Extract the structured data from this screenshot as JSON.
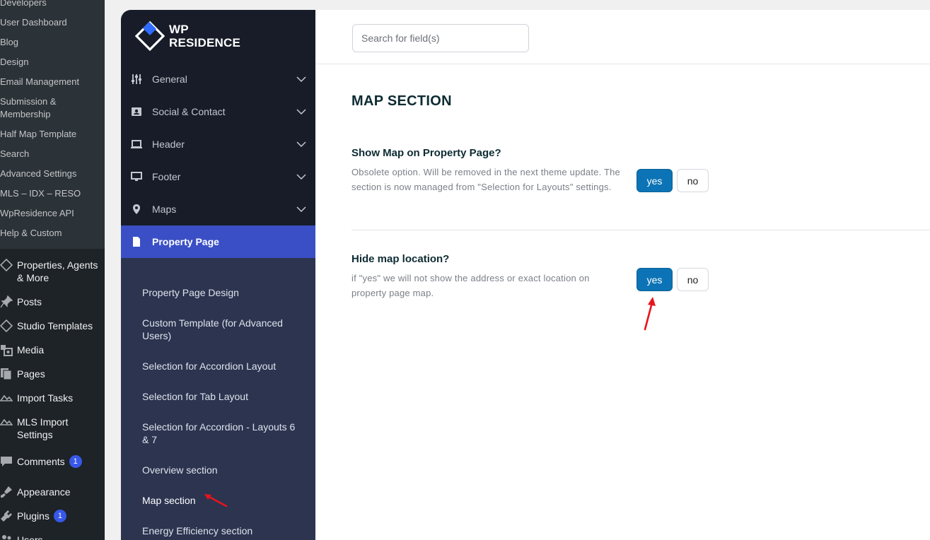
{
  "wp_submenu": [
    "Developers",
    "User Dashboard",
    "Blog",
    "Design",
    "Email Management",
    "Submission & Membership",
    "Half Map Template",
    "Search",
    "Advanced Settings",
    "MLS – IDX – RESO",
    "WpResidence API",
    "Help & Custom"
  ],
  "wp_menu": [
    {
      "label": "Properties, Agents & More",
      "icon": "wpresidence-diamond-icon"
    },
    {
      "label": "Posts",
      "icon": "pin-icon"
    },
    {
      "label": "Studio Templates",
      "icon": "wpresidence-diamond-icon"
    },
    {
      "label": "Media",
      "icon": "media-icon"
    },
    {
      "label": "Pages",
      "icon": "pages-icon"
    },
    {
      "label": "Import Tasks",
      "icon": "import-icon"
    },
    {
      "label": "MLS Import Settings",
      "icon": "import-icon"
    },
    {
      "label": "Comments",
      "icon": "comment-icon",
      "badge": "1"
    },
    {
      "label": "Appearance",
      "icon": "brush-icon"
    },
    {
      "label": "Plugins",
      "icon": "plugin-icon",
      "badge": "1"
    },
    {
      "label": "Users",
      "icon": "users-icon"
    }
  ],
  "logo": {
    "line1": "WP",
    "line2": "RESIDENCE"
  },
  "options_nav": [
    {
      "label": "General",
      "icon": "sliders-icon"
    },
    {
      "label": "Social & Contact",
      "icon": "contact-card-icon"
    },
    {
      "label": "Header",
      "icon": "laptop-icon"
    },
    {
      "label": "Footer",
      "icon": "monitor-icon"
    },
    {
      "label": "Maps",
      "icon": "map-pin-icon"
    },
    {
      "label": "Property Page",
      "icon": "document-icon",
      "active": true
    }
  ],
  "property_page_subnav": [
    "Property Page Design",
    "Custom Template (for Advanced Users)",
    "Selection for Accordion Layout",
    "Selection for Tab Layout",
    "Selection for Accordion - Layouts 6 & 7",
    "Overview section",
    "Map section",
    "Energy Efficiency section"
  ],
  "search": {
    "placeholder": "Search for field(s)"
  },
  "section_title": "MAP SECTION",
  "options": [
    {
      "title": "Show Map on Property Page?",
      "description": "Obsolete option. Will be removed in the next theme update. The section is now managed from \"Selection for Layouts\" settings.",
      "yes_label": "yes",
      "no_label": "no",
      "selected": "yes"
    },
    {
      "title": "Hide map location?",
      "description": "if \"yes\" we will not show the address or exact location on property page map.",
      "yes_label": "yes",
      "no_label": "no",
      "selected": "yes"
    }
  ],
  "colors": {
    "wp_sidebar": "#1d2327",
    "options_sidebar": "#171c28",
    "active_nav": "#3a4fc5",
    "subnav_bg": "#2c3450",
    "yes_button": "#0c74b6",
    "annotation_arrow": "#e8141b"
  }
}
